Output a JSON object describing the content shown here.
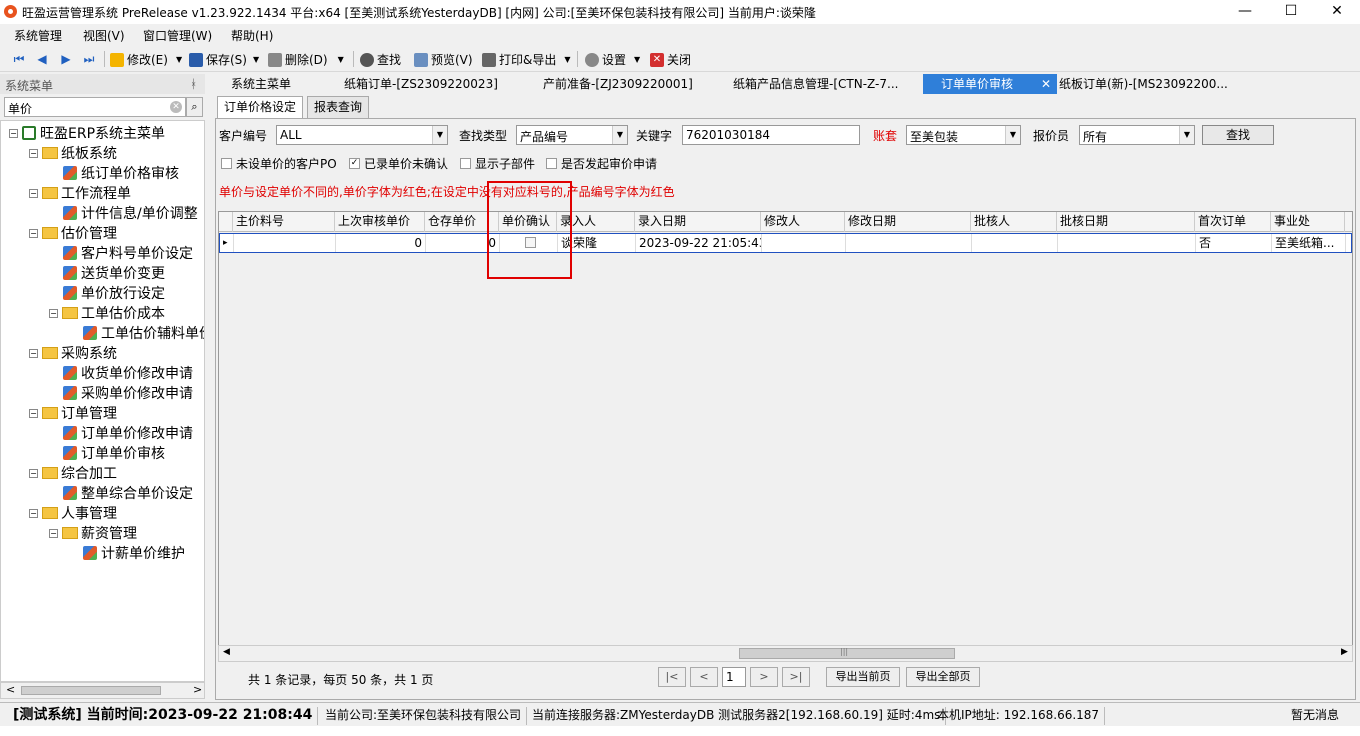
{
  "title": "旺盈运营管理系统 PreRelease v1.23.922.1434 平台:x64  [至美测试系统YesterdayDB] [内网] 公司:[至美环保包装科技有限公司] 当前用户:谈荣隆",
  "window": {
    "min": "—",
    "max": "☐",
    "close": "✕"
  },
  "menus": [
    "系统管理",
    "视图(V)",
    "窗口管理(W)",
    "帮助(H)"
  ],
  "toolbar": {
    "edit": "修改(E)",
    "save": "保存(S)",
    "delete": "删除(D)",
    "find": "查找",
    "preview": "预览(V)",
    "print": "打印&导出",
    "settings": "设置",
    "close": "关闭"
  },
  "sidebar": {
    "header": "系统菜单",
    "pin": "ᚼ",
    "search_value": "单价",
    "search_clear": "✕",
    "search_icon": "⌕",
    "tree": {
      "root": "旺盈ERP系统主菜单",
      "n1": "纸板系统",
      "n1a": "纸订单价格审核",
      "n2": "工作流程单",
      "n2a": "计件信息/单价调整",
      "n3": "估价管理",
      "n3a": "客户料号单价设定",
      "n3b": "送货单价变更",
      "n3c": "单价放行设定",
      "n3d": "工单估价成本",
      "n3d1": "工单估价辅料单价",
      "n4": "采购系统",
      "n4a": "收货单价修改申请",
      "n4b": "采购单价修改申请",
      "n5": "订单管理",
      "n5a": "订单单价修改申请",
      "n5b": "订单单价审核",
      "n6": "综合加工",
      "n6a": "整单综合单价设定",
      "n7": "人事管理",
      "n7a": "薪资管理",
      "n7a1": "计薪单价维护"
    },
    "scroll_left": "<",
    "scroll_right": ">"
  },
  "tabs": {
    "t1": "系统主菜单",
    "t2": "纸箱订单-[ZS2309220023]",
    "t3": "产前准备-[ZJ2309220001]",
    "t4": "纸箱产品信息管理-[CTN-Z-7...",
    "t5": "订单单价审核",
    "t5close": "✕",
    "t6": "纸板订单(新)-[MS23092200..."
  },
  "subtabs": {
    "s1": "订单价格设定",
    "s2": "报表查询"
  },
  "filters": {
    "customer_label": "客户编号",
    "customer_value": "ALL",
    "type_label": "查找类型",
    "type_value": "产品编号",
    "keyword_label": "关键字",
    "keyword_value": "76201030184",
    "account_label": "账套",
    "account_value": "至美包装",
    "quoter_label": "报价员",
    "quoter_value": "所有",
    "search_button": "查找",
    "arrow": "▼"
  },
  "checks": {
    "c1": "未设单价的客户PO",
    "c2": "已录单价未确认",
    "c3": "显示子部件",
    "c4": "是否发起审价申请",
    "checked_mark": "✓"
  },
  "notice": "单价与设定单价不同的,单价字体为红色;在设定中没有对应料号的,产品编号字体为红色",
  "grid": {
    "headers": [
      "主价料号",
      "上次审核单价",
      "仓存单价",
      "单价确认",
      "录入人",
      "录入日期",
      "修改人",
      "修改日期",
      "批核人",
      "批核日期",
      "首次订单",
      "事业处"
    ],
    "row": {
      "indicator": "▸",
      "part": "",
      "last_price": "0",
      "stock_price": "0",
      "entered_by": "谈荣隆",
      "entered_date": "2023-09-22 21:05:43",
      "first_order": "否",
      "division": "至美纸箱..."
    }
  },
  "hscroll": {
    "left": "◀",
    "right": "▶",
    "grip": "|||"
  },
  "pager": {
    "summary": "共 1 条记录，每页 50 条，共 1 页",
    "first": "|<",
    "prev": "<",
    "page": "1",
    "next": ">",
    "last": ">|",
    "export_current": "导出当前页",
    "export_all": "导出全部页"
  },
  "status": {
    "system": "[测试系统]  当前时间:2023-09-22 21:08:44",
    "company": "当前公司:至美环保包装科技有限公司",
    "server": "当前连接服务器:ZMYesterdayDB 测试服务器2[192.168.60.19] 延时:4ms",
    "ip": "本机IP地址: 192.168.66.187",
    "msg": "暂无消息"
  }
}
